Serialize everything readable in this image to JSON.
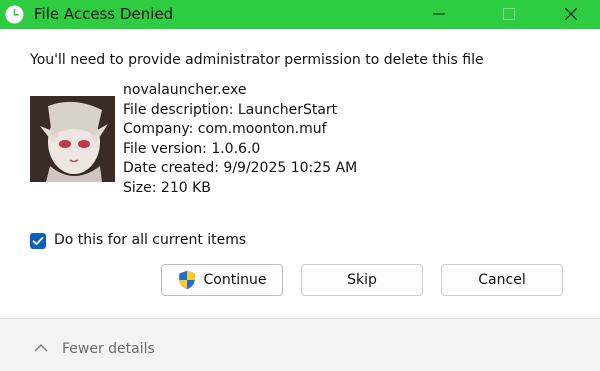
{
  "window": {
    "title": "File Access Denied",
    "titlebar_color": "#2ecc40"
  },
  "dialog": {
    "message": "You'll need to provide administrator permission to delete this file",
    "file": {
      "name": "novalauncher.exe",
      "description": "File description: LauncherStart",
      "company": "Company: com.moonton.muf",
      "version": "File version: 1.0.6.0",
      "date_created": "Date created: 9/9/2025 10:25 AM",
      "size": "Size: 210 KB"
    },
    "checkbox": {
      "label": "Do this for all current items",
      "checked": true
    },
    "buttons": {
      "continue": "Continue",
      "skip": "Skip",
      "cancel": "Cancel"
    },
    "footer": {
      "toggle_label": "Fewer details"
    }
  },
  "icons": {
    "app": "clock-icon",
    "continue": "uac-shield-icon",
    "footer": "chevron-up-icon"
  }
}
